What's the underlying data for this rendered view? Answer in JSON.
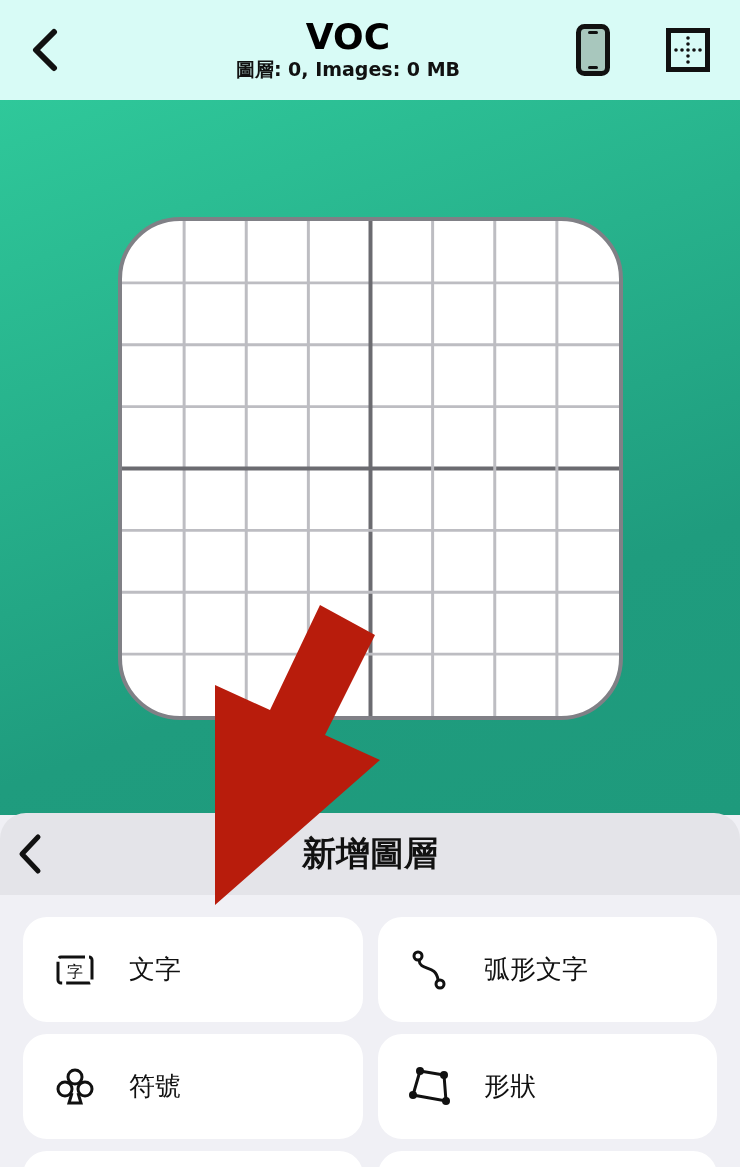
{
  "header": {
    "title": "VOC",
    "subtitle": "圖層: 0, Images: 0 MB"
  },
  "sheet": {
    "title": "新增圖層"
  },
  "items": [
    {
      "label": "文字",
      "kind": "text",
      "icon_text": "字"
    },
    {
      "label": "弧形文字",
      "kind": "curve"
    },
    {
      "label": "符號",
      "kind": "symbol"
    },
    {
      "label": "形狀",
      "kind": "shape"
    }
  ]
}
